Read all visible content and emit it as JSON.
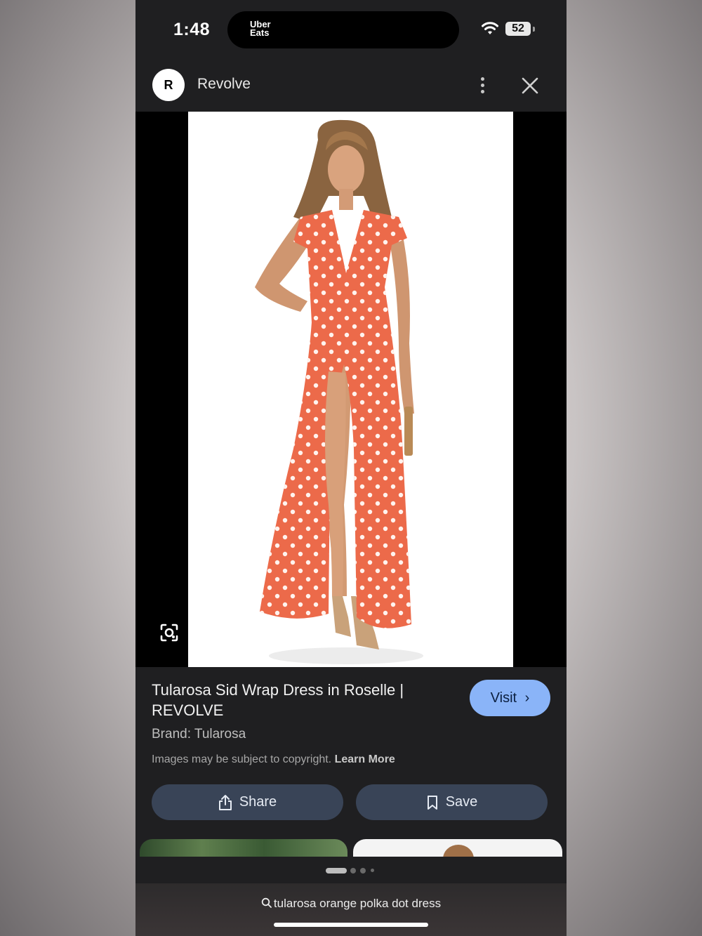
{
  "status_bar": {
    "time": "1:48",
    "live_activity_app": "Uber Eats",
    "battery": "52",
    "icons": [
      "wifi-icon",
      "battery-icon"
    ]
  },
  "header": {
    "logo_letter": "R",
    "site_name": "Revolve",
    "icons": [
      "more-vert-icon",
      "close-icon"
    ]
  },
  "result": {
    "title": "Tularosa Sid Wrap Dress in Roselle | REVOLVE",
    "visit_label": "Visit",
    "brand": "Brand: Tularosa",
    "copyright_text": "Images may be subject to copyright.",
    "learn_more": "Learn More",
    "share_label": "Share",
    "save_label": "Save",
    "image_icon": "lens-icon"
  },
  "pager": {
    "total": 4,
    "active": 1
  },
  "bottom": {
    "search_query": "tularosa orange polka dot dress"
  },
  "colors": {
    "background": "#1f1f21",
    "accent": "#8ab4f8",
    "button": "#394457",
    "dress": "#ec6a4a"
  }
}
